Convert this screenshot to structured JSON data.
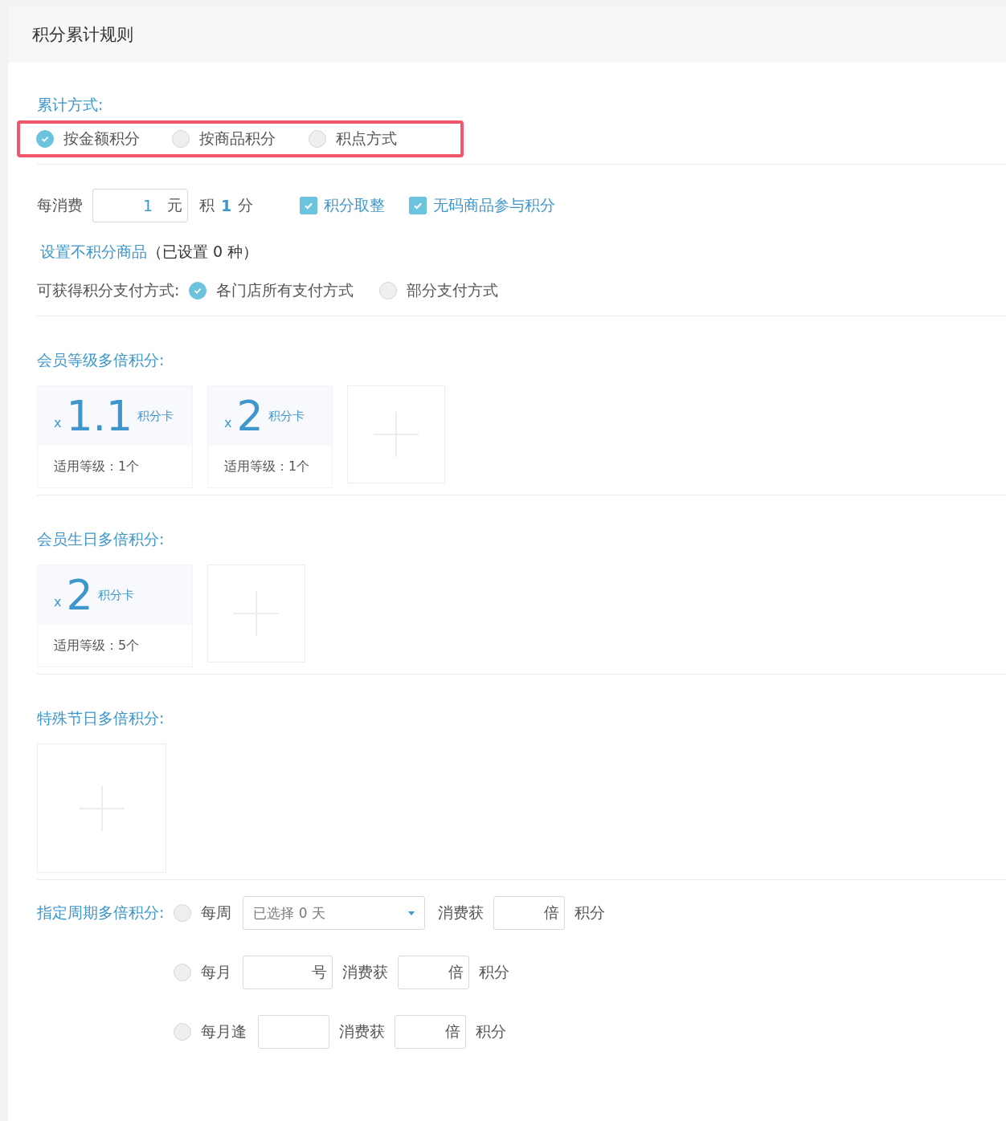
{
  "title": "积分累计规则",
  "accumulation": {
    "label": "累计方式:",
    "options": [
      {
        "label": "按金额积分",
        "selected": true
      },
      {
        "label": "按商品积分",
        "selected": false
      },
      {
        "label": "积点方式",
        "selected": false
      }
    ]
  },
  "spend": {
    "label": "每消费",
    "value": "1",
    "unit": "元",
    "earn": "积",
    "points": "1",
    "points_unit": "分",
    "checkboxes": [
      {
        "label": "积分取整",
        "checked": true
      },
      {
        "label": "无码商品参与积分",
        "checked": true
      }
    ]
  },
  "exclude": {
    "link": "设置不积分商品",
    "note": "（已设置 0 种）"
  },
  "payment": {
    "label": "可获得积分支付方式:",
    "options": [
      {
        "label": "各门店所有支付方式",
        "selected": true
      },
      {
        "label": "部分支付方式",
        "selected": false
      }
    ]
  },
  "multiplier_sections": [
    {
      "title": "会员等级多倍积分:",
      "cards": [
        {
          "prefix": "x",
          "value": "1.1",
          "unit": "积分卡",
          "levels": "适用等级：1个"
        },
        {
          "prefix": "x",
          "value": "2",
          "unit": "积分卡",
          "levels": "适用等级：1个"
        }
      ]
    },
    {
      "title": "会员生日多倍积分:",
      "cards": [
        {
          "prefix": "x",
          "value": "2",
          "unit": "积分卡",
          "levels": "适用等级：5个"
        }
      ]
    },
    {
      "title": "特殊节日多倍积分:"
    }
  ],
  "period": {
    "title": "指定周期多倍积分:",
    "rows": [
      {
        "label": "每周",
        "selected": false,
        "kind": "select",
        "field": "已选择 0 天",
        "earn": "消费获",
        "factor": "倍",
        "end": "积分"
      },
      {
        "label": "每月",
        "selected": false,
        "kind": "suffix",
        "field": "号",
        "earn": "消费获",
        "factor": "倍",
        "end": "积分"
      },
      {
        "label": "每月逢",
        "selected": false,
        "kind": "plain",
        "earn": "消费获",
        "factor": "倍",
        "end": "积分"
      }
    ]
  }
}
